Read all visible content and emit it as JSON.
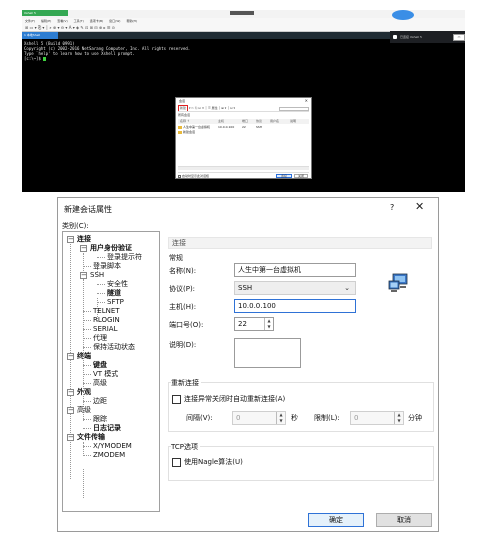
{
  "xshell": {
    "title": "Xshell 5",
    "center_mark": "",
    "menu": [
      "文件(F)",
      "编辑(E)",
      "查看(V)",
      "工具(T)",
      "选项卡(B)",
      "窗口(W)",
      "帮助(H)"
    ],
    "toolbar_text": "⊞ ▭ ▾ ⎘ ▾ │ ⌕ ⊕ ▾ ⊖ ▾ A ▾ ◈ ✎ ⊡ ⊞ ⊟ ⊕ ▸ ☰ ⊙",
    "tab_label": "1 本地Shell",
    "terminal_lines": [
      "Xshell 5 (Build 0991)",
      "Copyright (c) 2002-2016 NetSarang Computer, Inc. All rights reserved.",
      "",
      "Type `help' to learn how to use Xshell prompt.",
      "[c:\\~]$ "
    ],
    "dark_bar_text": "已连接 Xshell 5"
  },
  "mini_dialog": {
    "title": "会话",
    "toolbar_new": "新建",
    "toolbar_rest": " ▾ ✂ ⎘ ⊡ ✕ │ ☰ 属性 │ ⊞ ▾ │ ⊡ ▾",
    "section": "所有会话",
    "headers": [
      "名称 ↑",
      "主机",
      "端口",
      "协议",
      "用户名",
      "说明"
    ],
    "rows": [
      {
        "name": "人生中第一台虚拟机",
        "host": "10.0.0.100",
        "port": "22",
        "proto": "SSH"
      },
      {
        "name": "新建会话",
        "host": "",
        "port": "",
        "proto": ""
      }
    ],
    "startup_label": "启动时显示此对话框",
    "connect_label": "连接",
    "close_label": "关闭"
  },
  "dialog": {
    "title": "新建会话属性",
    "help": "?",
    "close": "✕",
    "category_label": "类别(C):",
    "tree": {
      "connect": "连接",
      "auth": "用户身份验证",
      "login_prompt": "登录提示符",
      "login_script": "登录脚本",
      "ssh": "SSH",
      "security": "安全性",
      "tunnel": "隧道",
      "sftp": "SFTP",
      "telnet": "TELNET",
      "rlogin": "RLOGIN",
      "serial": "SERIAL",
      "proxy": "代理",
      "keepalive": "保持活动状态",
      "terminal": "终端",
      "keyboard": "键盘",
      "vt": "VT 模式",
      "advanced1": "高级",
      "appearance": "外观",
      "margin": "边距",
      "advanced2": "高级",
      "trace": "跟踪",
      "logging": "日志记录",
      "filetransfer": "文件传输",
      "xymodem": "X/YMODEM",
      "zmodem": "ZMODEM"
    },
    "panel_title": "连接",
    "general": {
      "group": "常规",
      "name_label": "名称(N):",
      "name_value": "人生中第一台虚拟机",
      "protocol_label": "协议(P):",
      "protocol_value": "SSH",
      "host_label": "主机(H):",
      "host_value": "10.0.0.100",
      "port_label": "端口号(O):",
      "port_value": "22",
      "desc_label": "说明(D):",
      "desc_value": ""
    },
    "reconnect": {
      "group": "重新连接",
      "auto_label": "连接异常关闭时自动重新连接(A)",
      "interval_label": "间隔(V):",
      "interval_value": "0",
      "sec": "秒",
      "limit_label": "限制(L):",
      "limit_value": "0",
      "min": "分钟"
    },
    "tcp": {
      "group": "TCP选项",
      "nagle_label": "使用Nagle算法(U)"
    },
    "ok": "确定",
    "cancel": "取消"
  }
}
